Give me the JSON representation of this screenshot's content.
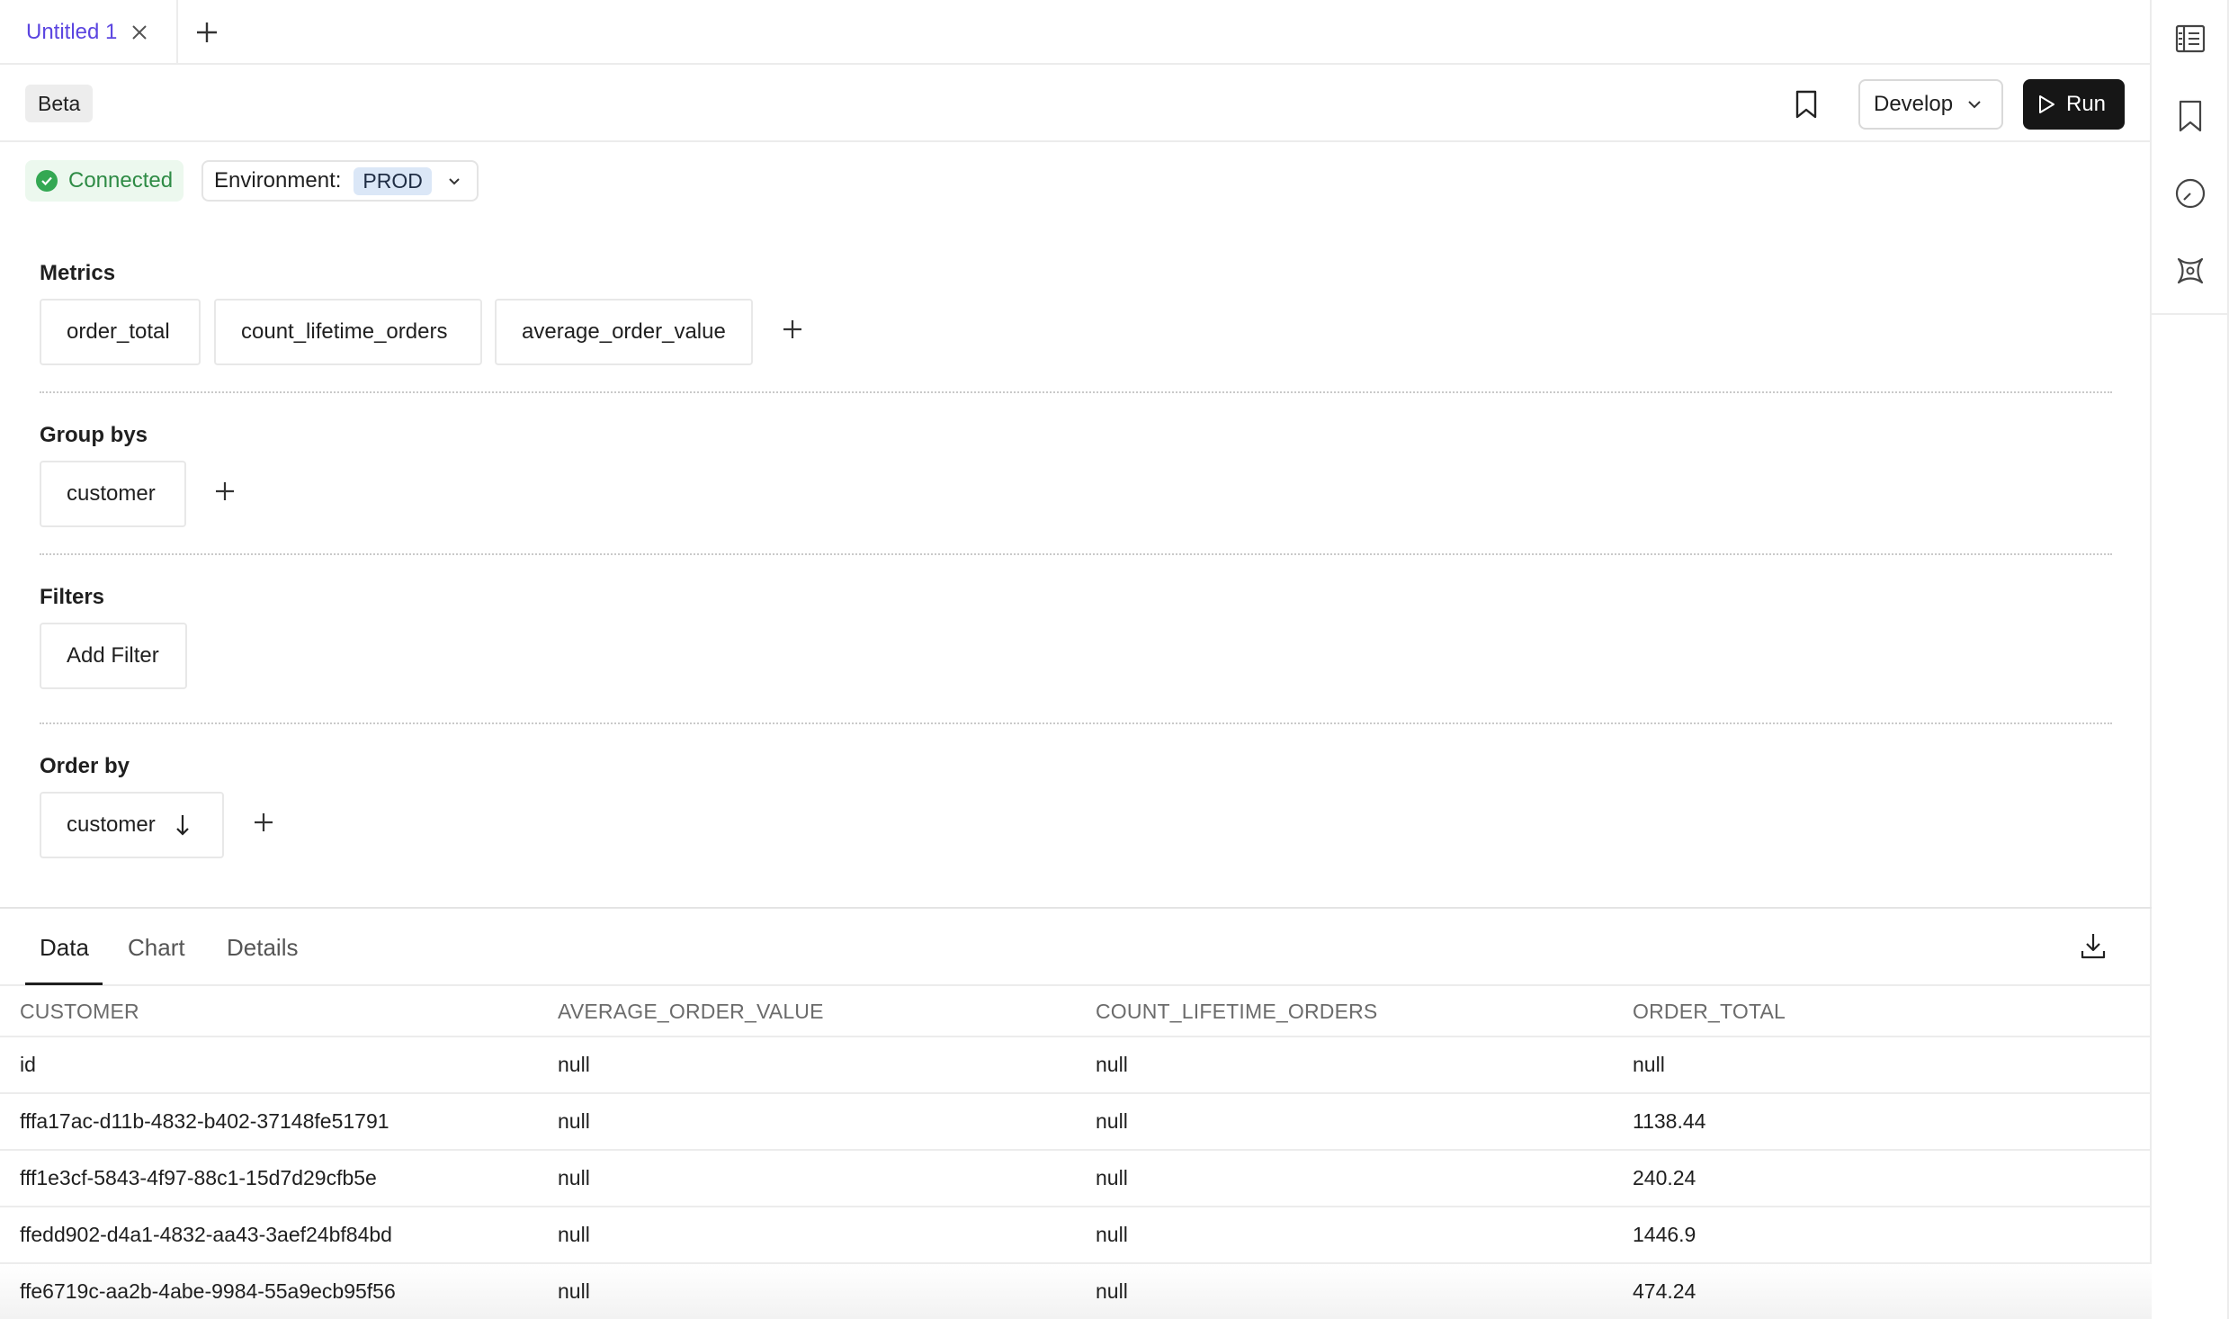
{
  "tabs": {
    "active_label": "Untitled 1"
  },
  "toolbar": {
    "beta_badge": "Beta",
    "develop_label": "Develop",
    "run_label": "Run"
  },
  "status": {
    "connected_label": "Connected",
    "environment_label": "Environment:",
    "environment_value": "PROD"
  },
  "sections": {
    "metrics": {
      "title": "Metrics",
      "items": [
        "order_total",
        "count_lifetime_orders",
        "average_order_value"
      ]
    },
    "group_bys": {
      "title": "Group bys",
      "items": [
        "customer"
      ]
    },
    "filters": {
      "title": "Filters",
      "add_label": "Add Filter"
    },
    "order_by": {
      "title": "Order by",
      "items": [
        "customer"
      ]
    }
  },
  "results": {
    "tabs": [
      "Data",
      "Chart",
      "Details"
    ],
    "active_tab": "Data",
    "columns": [
      "CUSTOMER",
      "AVERAGE_ORDER_VALUE",
      "COUNT_LIFETIME_ORDERS",
      "ORDER_TOTAL"
    ],
    "rows": [
      [
        "id",
        "null",
        "null",
        "null"
      ],
      [
        "fffa17ac-d11b-4832-b402-37148fe51791",
        "null",
        "null",
        "1138.44"
      ],
      [
        "fff1e3cf-5843-4f97-88c1-15d7d29cfb5e",
        "null",
        "null",
        "240.24"
      ],
      [
        "ffedd902-d4a1-4832-aa43-3aef24bf84bd",
        "null",
        "null",
        "1446.9"
      ],
      [
        "ffe6719c-aa2b-4abe-9984-55a9ecb95f56",
        "null",
        "null",
        "474.24"
      ]
    ]
  },
  "icons": {
    "tab_close": "close-icon",
    "tab_add": "plus-icon",
    "bookmark": "bookmark-icon",
    "develop_chevron": "chevron-down-icon",
    "run": "play-icon",
    "connected": "check-circle-icon",
    "env_chevron": "chevron-down-icon",
    "order_direction": "arrow-down-icon",
    "download": "download-icon",
    "rail": [
      "list-panel-icon",
      "bookmark-icon",
      "history-clock-icon",
      "semantic-layer-icon"
    ]
  },
  "colors": {
    "accent": "#5b45e0",
    "run_button": "#161616",
    "connected_bg": "#ecf8ee",
    "connected_text": "#2e8b45",
    "env_badge_bg": "#dbe7f7"
  }
}
